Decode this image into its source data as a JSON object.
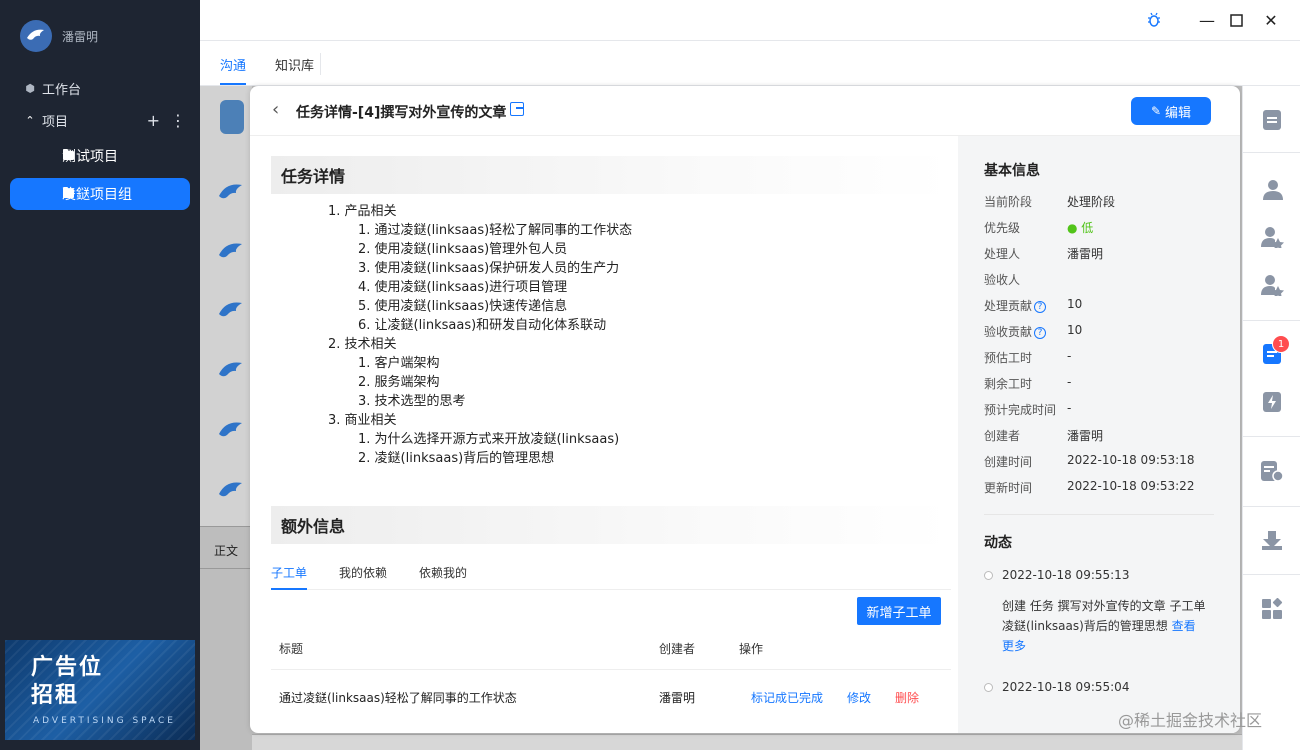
{
  "user": {
    "name": "潘雷明"
  },
  "nav": {
    "workbench": "工作台",
    "projects": "项目",
    "project_items": [
      "测试项目",
      "凌鎹项目组"
    ]
  },
  "ad": {
    "title_line1": "广告位",
    "title_line2": "招租",
    "subtitle": "ADVERTISING SPACE"
  },
  "tabs": [
    "沟通",
    "知识库"
  ],
  "behind": {
    "label": "正文"
  },
  "card": {
    "title": "任务详情-[4]撰写对外宣传的文章",
    "edit_label": "编辑",
    "section_detail": "任务详情",
    "section_extra": "额外信息",
    "outline": [
      {
        "n": "1.",
        "text": "产品相关",
        "children": [
          "通过凌鎹(linksaas)轻松了解同事的工作状态",
          "使用凌鎹(linksaas)管理外包人员",
          "使用凌鎹(linksaas)保护研发人员的生产力",
          "使用凌鎹(linksaas)进行项目管理",
          "使用凌鎹(linksaas)快速传递信息",
          "让凌鎹(linksaas)和研发自动化体系联动"
        ]
      },
      {
        "n": "2.",
        "text": "技术相关",
        "children": [
          "客户端架构",
          "服务端架构",
          "技术选型的思考"
        ]
      },
      {
        "n": "3.",
        "text": "商业相关",
        "children": [
          "为什么选择开源方式来开放凌鎹(linksaas)",
          "凌鎹(linksaas)背后的管理思想"
        ]
      }
    ],
    "sub_tabs": [
      "子工单",
      "我的依赖",
      "依赖我的"
    ],
    "add_sub_label": "新增子工单",
    "table_headers": [
      "标题",
      "创建者",
      "操作"
    ],
    "table_rows": [
      {
        "title": "通过凌鎹(linksaas)轻松了解同事的工作状态",
        "creator": "潘雷明",
        "mark_done": "标记成已完成",
        "edit": "修改",
        "delete": "删除"
      }
    ]
  },
  "info": {
    "title": "基本信息",
    "rows": [
      {
        "k": "当前阶段",
        "v": "处理阶段"
      },
      {
        "k": "优先级",
        "v": "● 低"
      },
      {
        "k": "处理人",
        "v": "潘雷明"
      },
      {
        "k": "验收人",
        "v": ""
      },
      {
        "k": "处理贡献",
        "v": "10"
      },
      {
        "k": "验收贡献",
        "v": "10"
      },
      {
        "k": "预估工时",
        "v": "-"
      },
      {
        "k": "剩余工时",
        "v": "-"
      },
      {
        "k": "预计完成时间",
        "v": "-"
      },
      {
        "k": "创建者",
        "v": "潘雷明"
      },
      {
        "k": "创建时间",
        "v": "2022-10-18 09:53:18"
      },
      {
        "k": "更新时间",
        "v": "2022-10-18 09:53:22"
      }
    ]
  },
  "activity": {
    "title": "动态",
    "items": [
      {
        "time": "2022-10-18 09:55:13",
        "text": "创建 任务 撰写对外宣传的文章 子工单 凌鎹(linksaas)背后的管理思想 ",
        "more": "查看更多"
      },
      {
        "time": "2022-10-18 09:55:04"
      }
    ]
  },
  "right_strip": {
    "badge_count": "1"
  },
  "watermark": "@稀土掘金技术社区",
  "colors": {
    "accent": "#1677ff",
    "sidebar_bg": "#1e2532",
    "danger": "#ff4d4f",
    "success": "#52c41a"
  }
}
